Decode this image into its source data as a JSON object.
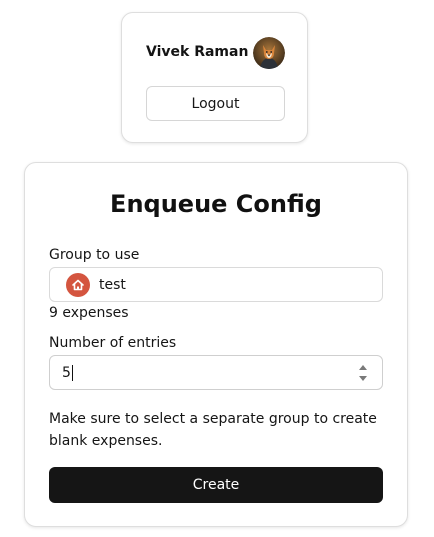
{
  "user": {
    "name": "Vivek Raman",
    "avatar_icon": "user-avatar-photo",
    "logout_label": "Logout"
  },
  "config": {
    "title": "Enqueue Config",
    "group": {
      "label": "Group to use",
      "selected": "test",
      "icon": "home-icon",
      "icon_color": "#d4553f"
    },
    "expense_count": "9 expenses",
    "entries": {
      "label": "Number of entries",
      "value": "5"
    },
    "help_text": "Make sure to select a separate group to create blank expenses.",
    "create_label": "Create"
  },
  "colors": {
    "primary_button": "#151515",
    "border": "#dedede"
  }
}
